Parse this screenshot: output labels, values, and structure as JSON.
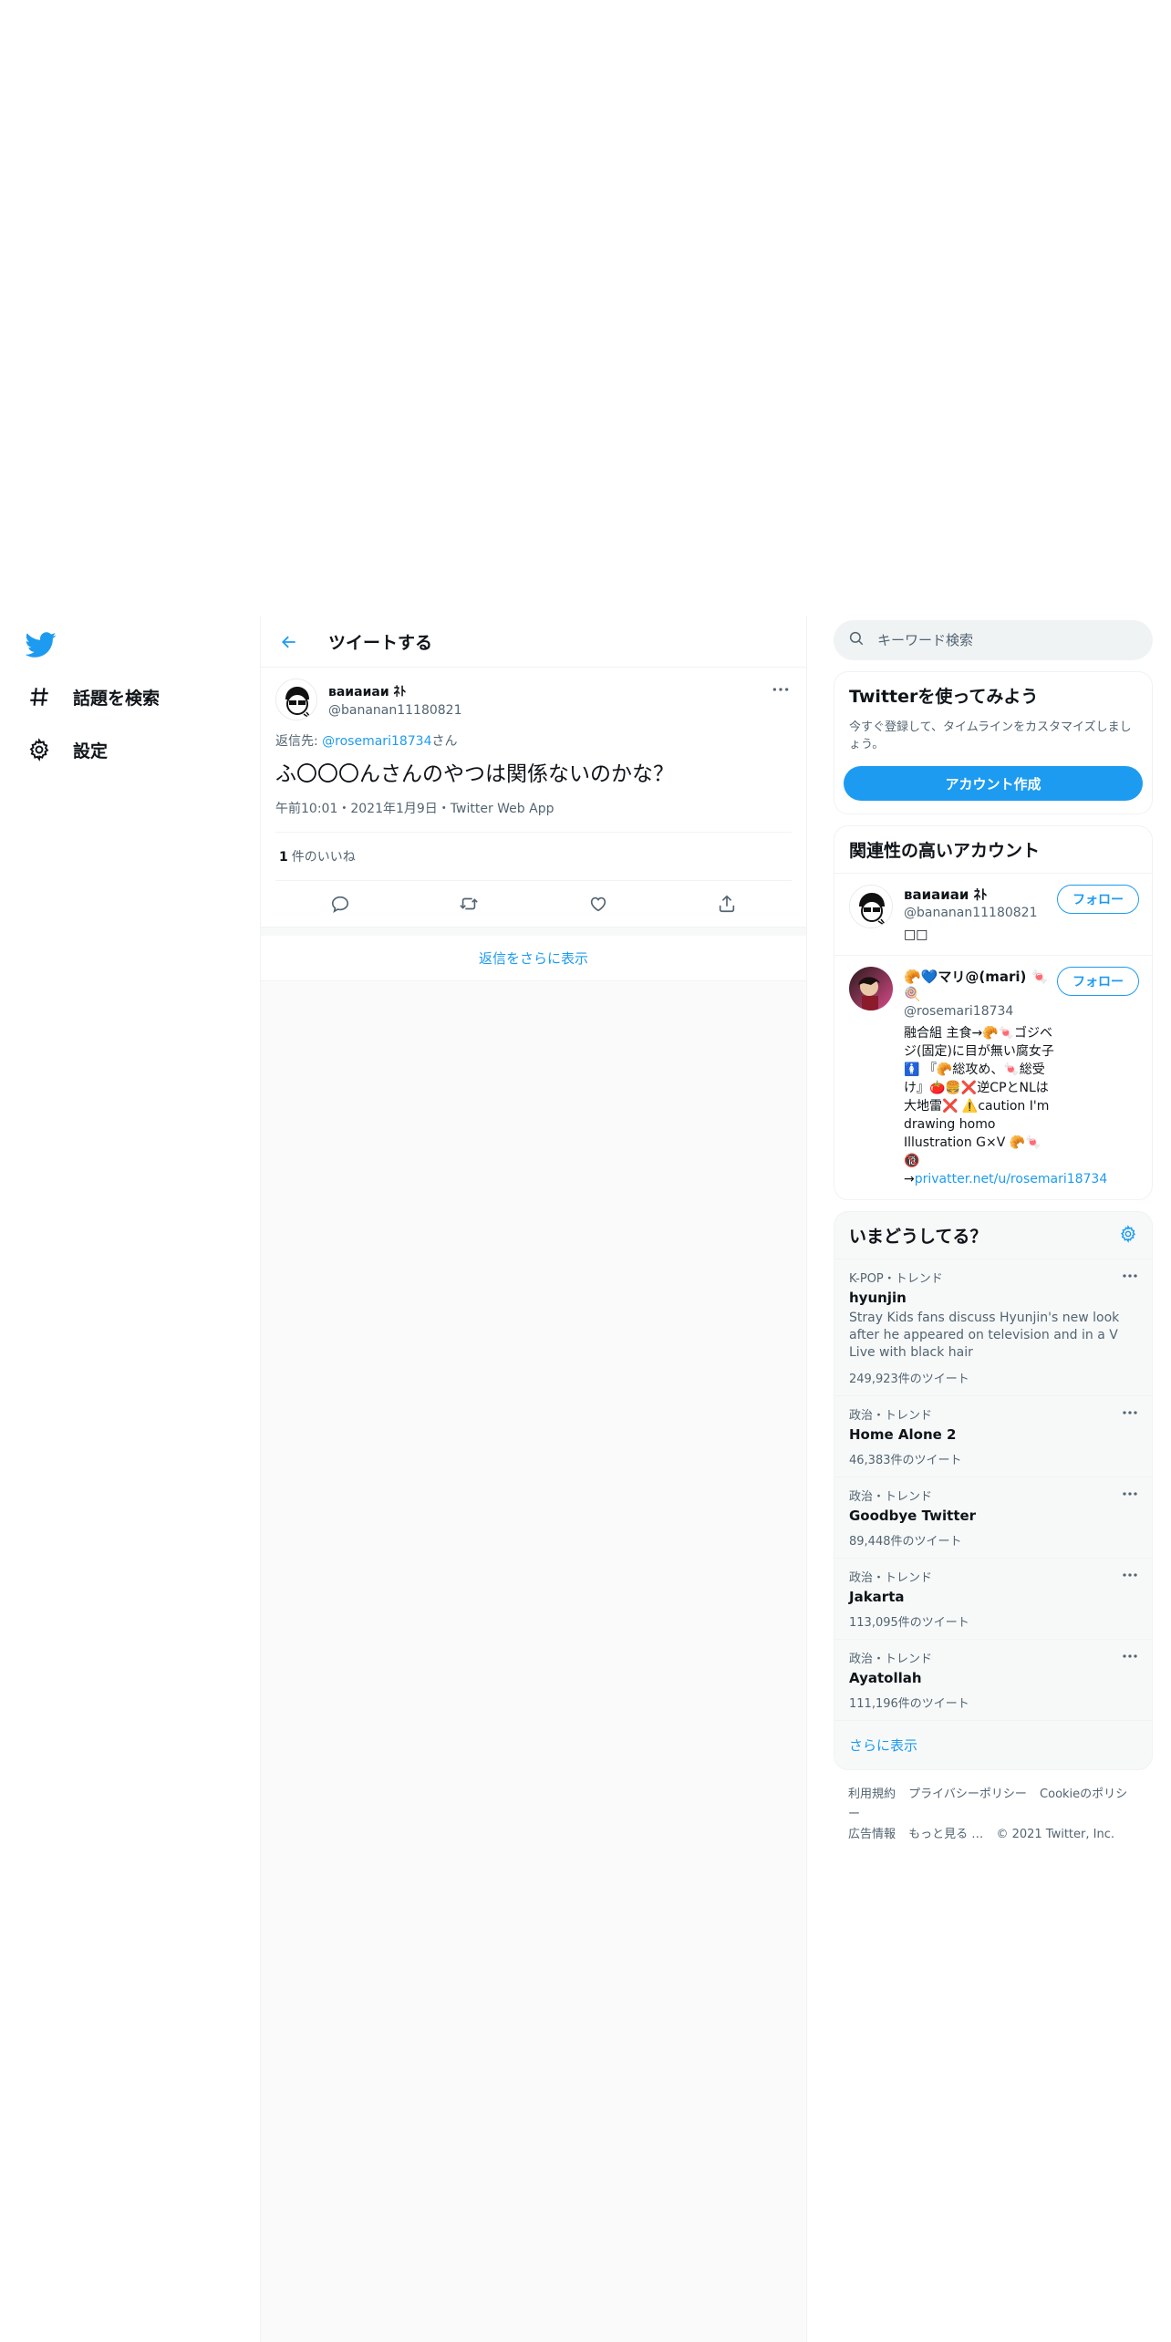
{
  "colors": {
    "accent": "#1d9bf0",
    "text": "#0f1419",
    "secondary": "#536471"
  },
  "nav": {
    "items": [
      {
        "label": "話題を検索",
        "icon": "hashtag-icon"
      },
      {
        "label": "設定",
        "icon": "gear-icon"
      }
    ]
  },
  "header": {
    "title": "ツイートする"
  },
  "tweet": {
    "display_name": "вaиaиaи ﾈﾄ",
    "handle": "@bananan11180821",
    "reply_prefix": "返信先: ",
    "reply_user": "@rosemari18734",
    "reply_suffix": "さん",
    "text": "ふ〇〇〇んさんのやつは関係ないのかな？",
    "meta": "午前10:01・2021年1月9日・Twitter Web App",
    "likes_count": "1",
    "likes_label": "件のいいね"
  },
  "show_more_replies": "返信をさらに表示",
  "search": {
    "placeholder": "キーワード検索"
  },
  "signup": {
    "title": "Twitterを使ってみよう",
    "desc": "今すぐ登録して、タイムラインをカスタマイズしましょう。",
    "button": "アカウント作成"
  },
  "relevant": {
    "title": "関連性の高いアカウント",
    "follow_label": "フォロー",
    "accounts": [
      {
        "name": "вaиaиaи ﾈﾄ",
        "handle": "@bananan11180821",
        "bio": "□□"
      },
      {
        "name": "🥐💙マリ@(mari) 🍬🍭",
        "handle": "@rosemari18734",
        "bio": "融合組 主食→🥐🍬ゴジベジ(固定)に目が無い腐女子 🚺 『🥐総攻め、🍬総受け』🍅🍔❌逆CPとNLは大地雷❌ ⚠️caution I'm drawing homo Illustration G×V 🥐🍬 🔞",
        "bio_link_prefix": "→",
        "bio_link": "privatter.net/u/rosemari18734"
      }
    ]
  },
  "trends": {
    "title": "いまどうしてる？",
    "items": [
      {
        "context": "K-POP・トレンド",
        "name": "hyunjin",
        "desc": "Stray Kids fans discuss Hyunjin's new look after he appeared on television and in a V Live with black hair",
        "count": "249,923件のツイート"
      },
      {
        "context": "政治・トレンド",
        "name": "Home Alone 2",
        "desc": "",
        "count": "46,383件のツイート"
      },
      {
        "context": "政治・トレンド",
        "name": "Goodbye Twitter",
        "desc": "",
        "count": "89,448件のツイート"
      },
      {
        "context": "政治・トレンド",
        "name": "Jakarta",
        "desc": "",
        "count": "113,095件のツイート"
      },
      {
        "context": "政治・トレンド",
        "name": "Ayatollah",
        "desc": "",
        "count": "111,196件のツイート"
      }
    ],
    "show_more": "さらに表示"
  },
  "footer": {
    "line1": [
      "利用規約",
      "プライバシーポリシー",
      "Cookieのポリシー"
    ],
    "line2": [
      "広告情報",
      "もっと見る …",
      "© 2021 Twitter, Inc."
    ]
  }
}
